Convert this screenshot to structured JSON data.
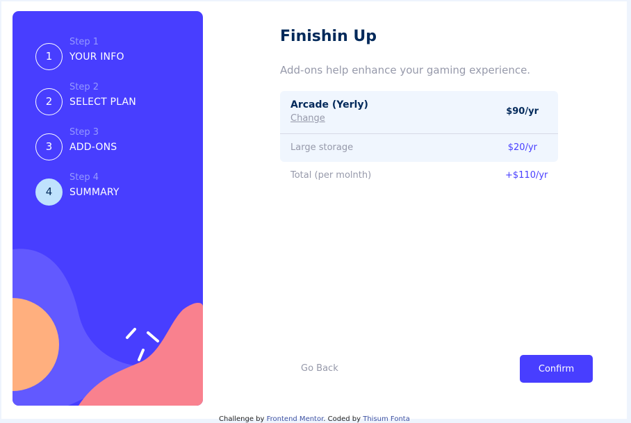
{
  "sidebar": {
    "steps": [
      {
        "number": "1",
        "caption": "Step 1",
        "title": "YOUR INFO"
      },
      {
        "number": "2",
        "caption": "Step 2",
        "title": "SELECT PLAN"
      },
      {
        "number": "3",
        "caption": "Step 3",
        "title": "ADD-ONS"
      },
      {
        "number": "4",
        "caption": "Step 4",
        "title": "SUMMARY"
      }
    ],
    "active_step": 4
  },
  "main": {
    "title": "Finishin Up",
    "description": "Add-ons help enhance your gaming experience.",
    "summary": {
      "plan_name": "Arcade (Yerly)",
      "change_label": "Change",
      "plan_price": "$90/yr",
      "addons": [
        {
          "name": "Large storage",
          "price": "$20/yr"
        }
      ]
    },
    "total": {
      "label": "Total (per molnth)",
      "value": "+$110/yr"
    }
  },
  "footer": {
    "back_label": "Go Back",
    "confirm_label": "Confirm"
  },
  "attribution": {
    "prefix": "Challenge by ",
    "challenge_link": "Frontend Mentor",
    "middle": ". Coded by ",
    "author_link": "Thisum Fonta"
  },
  "colors": {
    "sidebar_bg": "#483eff",
    "active_step_bg": "#bfe2fd",
    "title": "#02295a",
    "muted": "#9699aa",
    "accent": "#483eff",
    "summary_bg": "#f0f6fe"
  }
}
